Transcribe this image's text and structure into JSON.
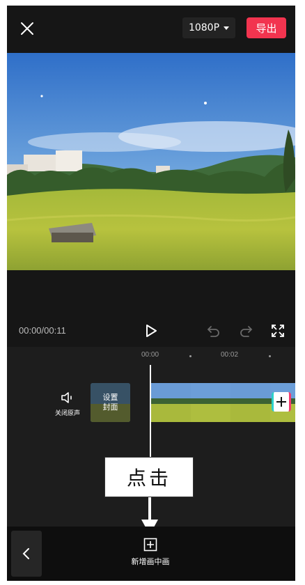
{
  "top_bar": {
    "close_icon": "close-icon",
    "resolution_label": "1080P",
    "export_label": "导出",
    "export_color": "#f2344f"
  },
  "preview": {
    "description_icon": "video-frame"
  },
  "playback": {
    "timecode": "00:00/00:11",
    "play_icon": "play-icon",
    "undo_icon": "undo-icon",
    "redo_icon": "redo-icon",
    "fullscreen_icon": "fullscreen-icon"
  },
  "timeline": {
    "ticks": [
      "00:00",
      "00:02"
    ],
    "mute_label": "关闭原声",
    "cover_label": "设置\n封面",
    "add_clip_icon": "plus-icon"
  },
  "annotation": {
    "text": "点击"
  },
  "bottom_bar": {
    "back_icon": "chevron-left-icon",
    "pip_label": "新增画中画",
    "pip_icon": "add-square-icon"
  }
}
